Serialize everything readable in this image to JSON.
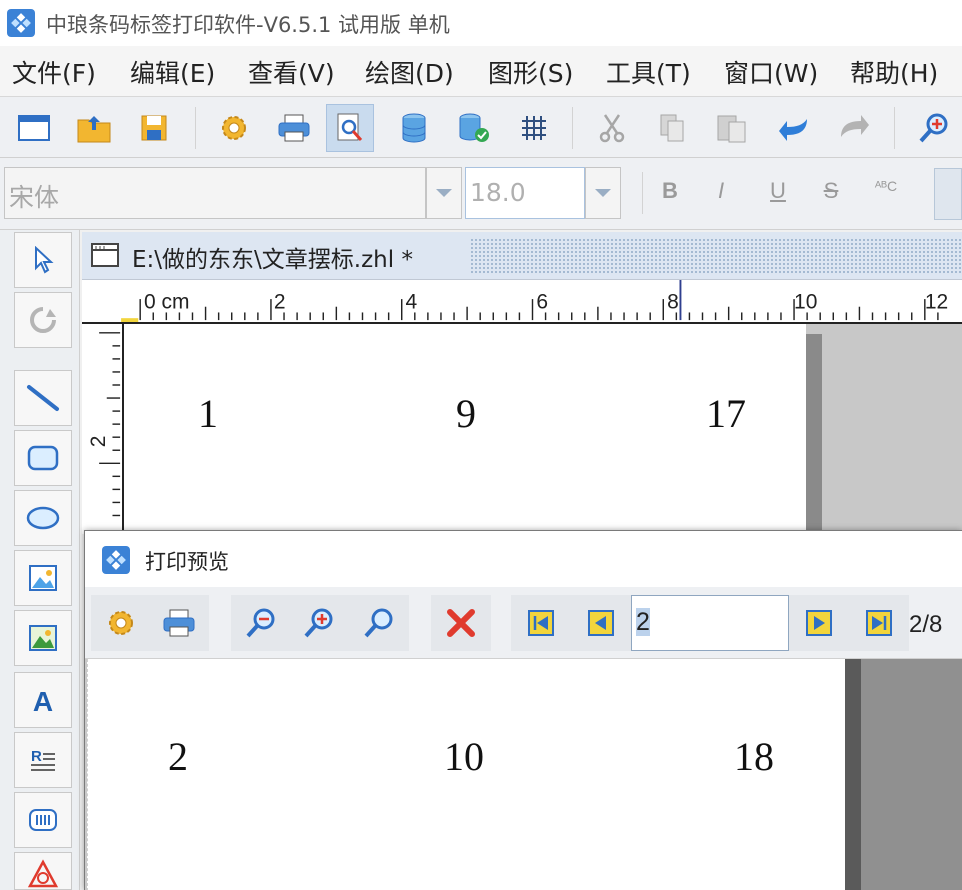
{
  "window": {
    "title": "中琅条码标签打印软件-V6.5.1 试用版 单机"
  },
  "menu": [
    {
      "label": "文件(F)"
    },
    {
      "label": "编辑(E)"
    },
    {
      "label": "查看(V)"
    },
    {
      "label": "绘图(D)"
    },
    {
      "label": "图形(S)"
    },
    {
      "label": "工具(T)"
    },
    {
      "label": "窗口(W)"
    },
    {
      "label": "帮助(H)"
    }
  ],
  "toolbar": {
    "buttons": [
      "new-icon",
      "open-icon",
      "save-icon",
      "settings-icon",
      "print-icon",
      "print-preview-icon",
      "database-icon",
      "database-connect-icon",
      "grid-icon",
      "cut-icon",
      "copy-icon",
      "paste-icon",
      "undo-icon",
      "redo-icon",
      "zoom-icon"
    ],
    "active": "print-preview-icon"
  },
  "format": {
    "font_value": "宋体",
    "size_value": "18.0",
    "bold": "B",
    "italic": "I",
    "underline": "U",
    "strike": "S",
    "abc": "ᴬᴮC"
  },
  "document": {
    "tab_title": "E:\\做的东东\\文章摆标.zhl *",
    "ruler_unit": "0 cm",
    "ruler_ticks": [
      "2",
      "4",
      "6",
      "8",
      "10",
      "12"
    ],
    "ruler_v_ticks": [
      "2"
    ],
    "labels": [
      "1",
      "9",
      "17"
    ]
  },
  "preview": {
    "title": "打印预览",
    "page_input": "2",
    "page_count": "2/8",
    "labels": [
      "2",
      "10",
      "18"
    ]
  },
  "colors": {
    "accent": "#2f6fc4",
    "close_red": "#e03b2e",
    "nav_yellow": "#f2d53c"
  }
}
